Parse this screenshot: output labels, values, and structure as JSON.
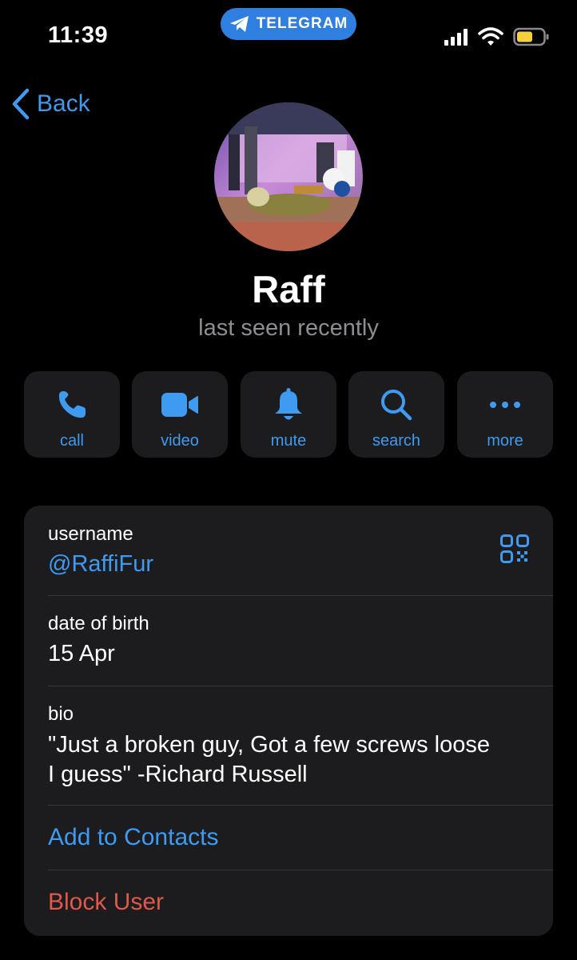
{
  "status_bar": {
    "time": "11:39",
    "app_pill": "TELEGRAM"
  },
  "nav": {
    "back_label": "Back"
  },
  "profile": {
    "name": "Raff",
    "status": "last seen recently"
  },
  "actions": [
    {
      "label": "call",
      "icon": "phone-icon"
    },
    {
      "label": "video",
      "icon": "video-camera-icon"
    },
    {
      "label": "mute",
      "icon": "bell-icon"
    },
    {
      "label": "search",
      "icon": "search-icon"
    },
    {
      "label": "more",
      "icon": "ellipsis-icon"
    }
  ],
  "info": {
    "username_label": "username",
    "username_value": "@RaffiFur",
    "birth_label": "date of birth",
    "birth_value": "15 Apr",
    "bio_label": "bio",
    "bio_line1": "\"Just a broken guy, Got a few screws loose",
    "bio_line2": "I guess\" -Richard Russell",
    "add_contact": "Add to Contacts",
    "block_user": "Block User"
  },
  "colors": {
    "accent": "#3e9bf0",
    "danger": "#e0584a",
    "card": "#1c1c1e",
    "secondary_text": "#8d8d92"
  }
}
